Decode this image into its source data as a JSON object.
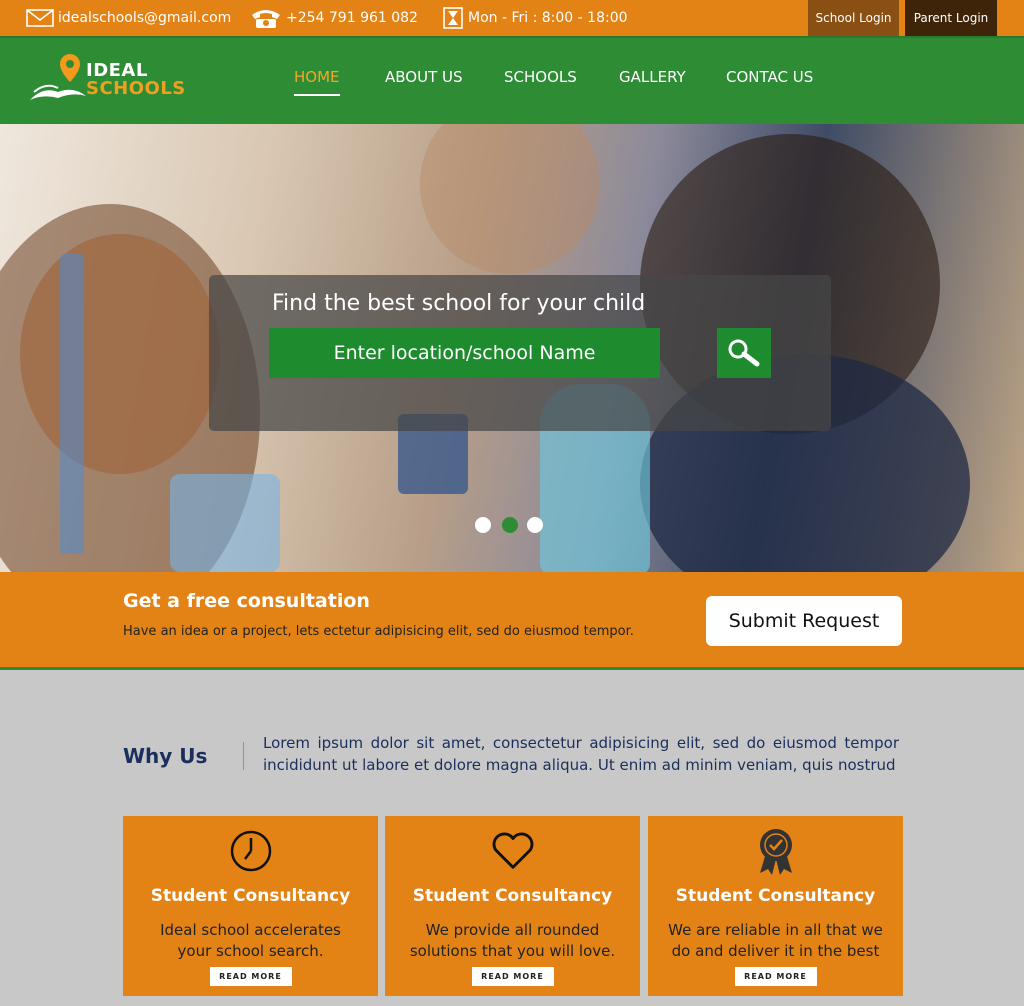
{
  "topbar": {
    "email": "idealschools@gmail.com",
    "phone": "+254 791 961 082",
    "hours": "Mon - Fri : 8:00 - 18:00",
    "school_login": "School Login",
    "parent_login": "Parent Login"
  },
  "header": {
    "logo_line1": "IDEAL",
    "logo_line2": "SCHOOLS",
    "nav": [
      "HOME",
      "ABOUT US",
      "SCHOOLS",
      "GALLERY",
      "CONTAC US"
    ],
    "active_nav": "HOME"
  },
  "hero": {
    "title": "Find the best school for your child",
    "search_placeholder": "Enter location/school Name",
    "slides": 3,
    "active_slide": 2
  },
  "consultation": {
    "title": "Get a free consultation",
    "text": "Have an idea or a project, lets ectetur adipisicing elit, sed do eiusmod tempor.",
    "button": "Submit Request"
  },
  "why_us": {
    "title": "Why Us",
    "text": "Lorem ipsum dolor sit amet, consectetur adipisicing elit, sed do eiusmod tempor incididunt ut labore et dolore magna aliqua. Ut enim ad minim veniam, quis nostrud"
  },
  "cards": [
    {
      "icon": "clock-icon",
      "title": "Student Consultancy",
      "text": "Ideal school accelerates your school search.",
      "button": "READ MORE"
    },
    {
      "icon": "heart-icon",
      "title": "Student Consultancy",
      "text": "We provide all rounded solutions that you will love.",
      "button": "READ MORE"
    },
    {
      "icon": "award-badge-icon",
      "title": "Student Consultancy",
      "text": "We are reliable in all that we do and deliver it in the best",
      "button": "READ MORE"
    }
  ],
  "colors": {
    "orange": "#e38315",
    "green": "#2d8c34",
    "navy": "#1b2f5c"
  }
}
